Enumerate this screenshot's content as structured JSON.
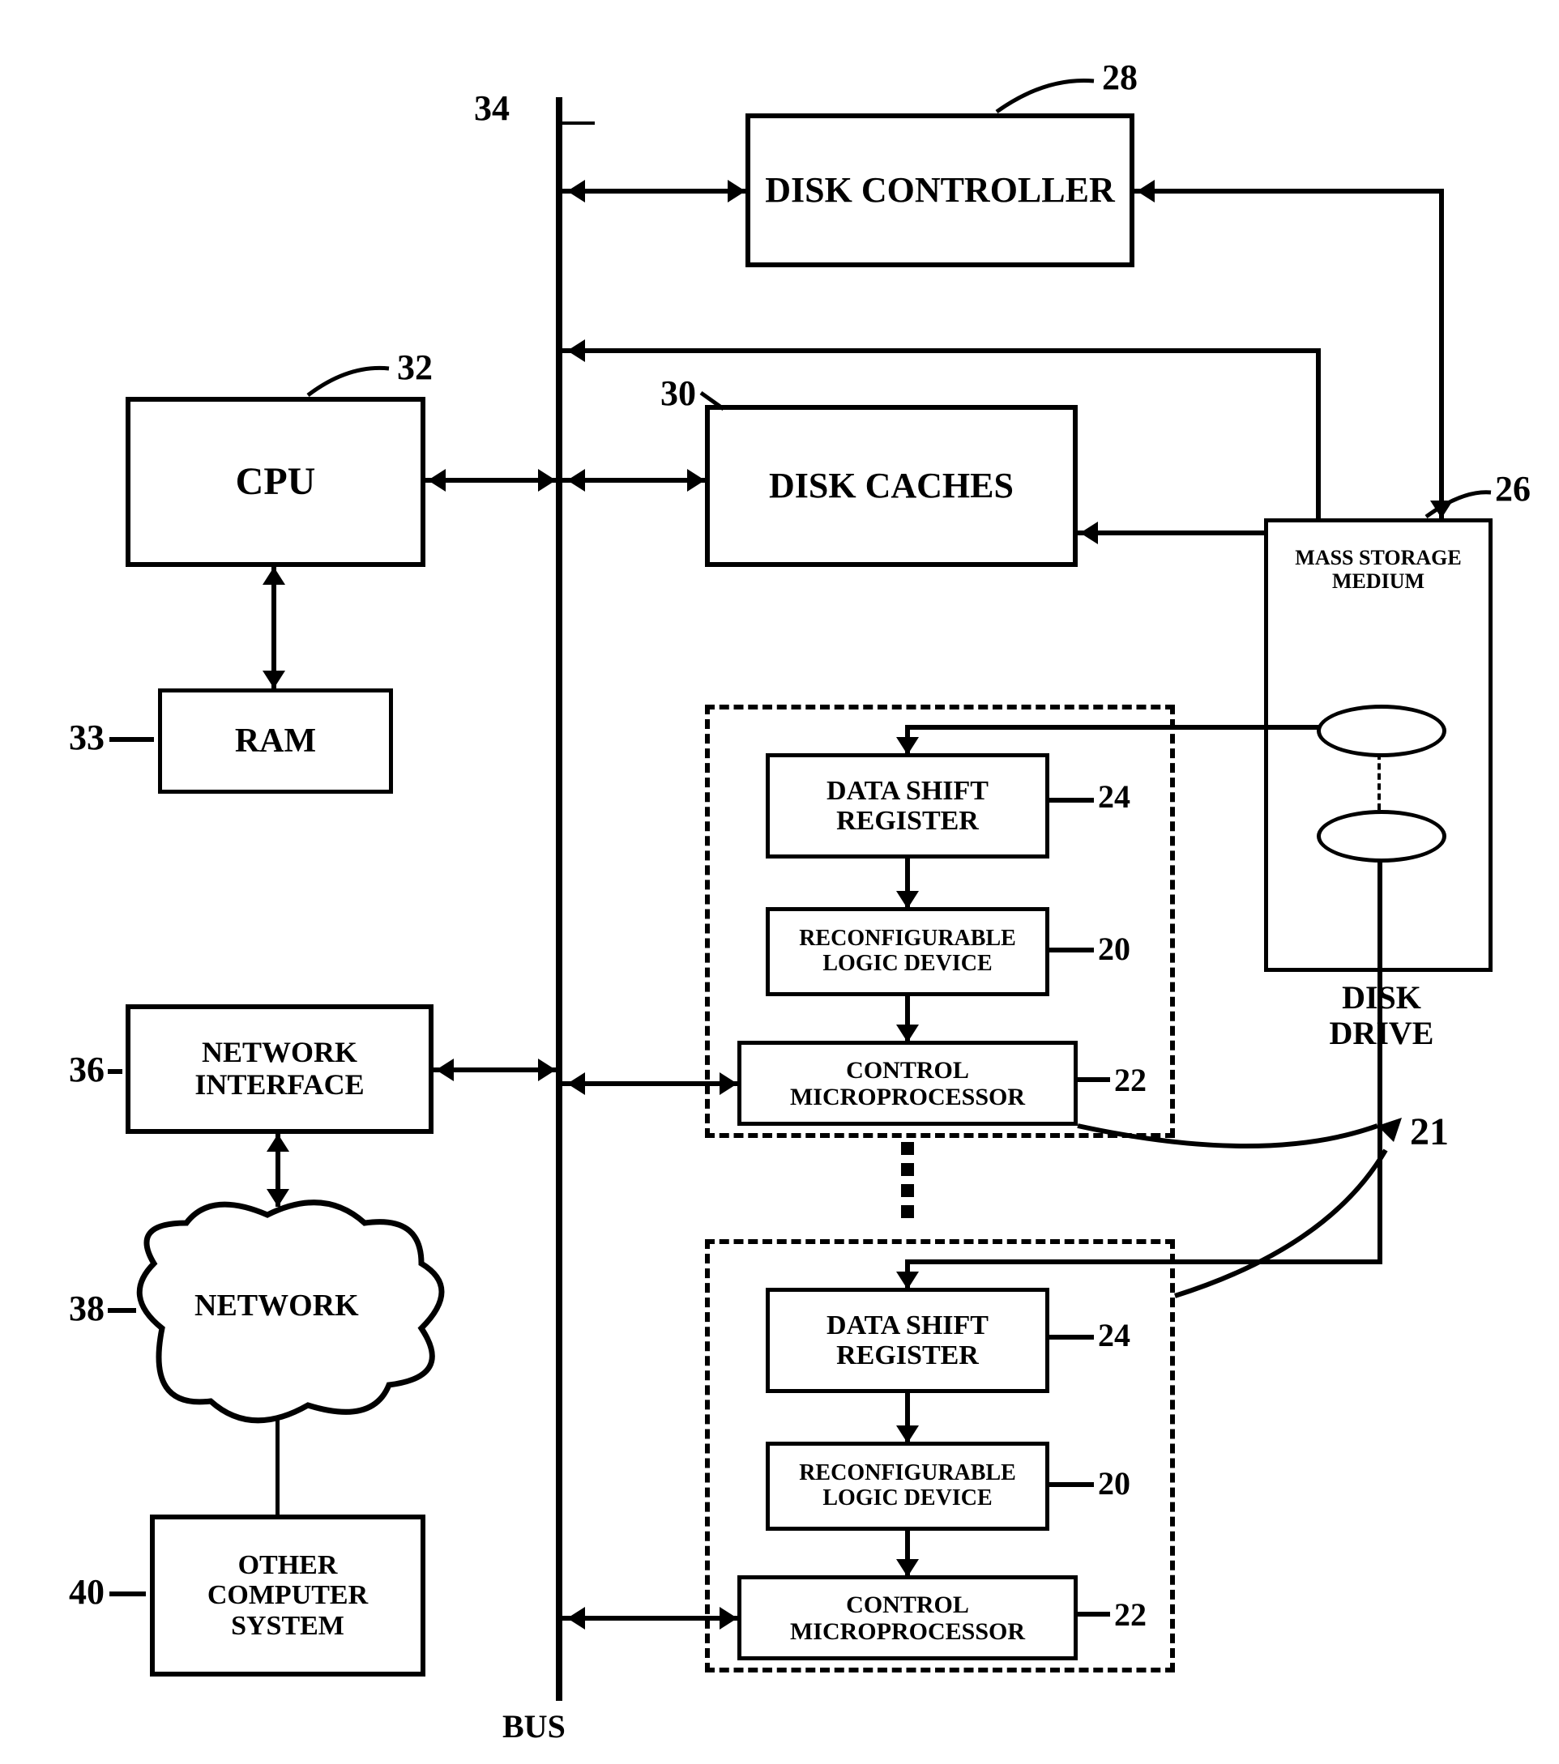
{
  "refs": {
    "disk_controller": "28",
    "bus": "34",
    "cpu": "32",
    "disk_caches": "30",
    "mass_storage": "26",
    "ram": "33",
    "data_shift_register_a": "24",
    "reconfig_logic_a": "20",
    "control_micro_a": "22",
    "group": "21",
    "data_shift_register_b": "24",
    "reconfig_logic_b": "20",
    "control_micro_b": "22",
    "network_interface": "36",
    "network": "38",
    "other_system": "40"
  },
  "labels": {
    "disk_controller": "DISK CONTROLLER",
    "cpu": "CPU",
    "disk_caches": "DISK CACHES",
    "mass_storage": "MASS STORAGE MEDIUM",
    "ram": "RAM",
    "data_shift_register": "DATA SHIFT REGISTER",
    "reconfig_logic": "RECONFIGURABLE LOGIC DEVICE",
    "control_micro": "CONTROL MICROPROCESSOR",
    "network_interface": "NETWORK INTERFACE",
    "network": "NETWORK",
    "other_system": "OTHER COMPUTER SYSTEM",
    "disk_drive": "DISK DRIVE",
    "bus": "BUS"
  }
}
